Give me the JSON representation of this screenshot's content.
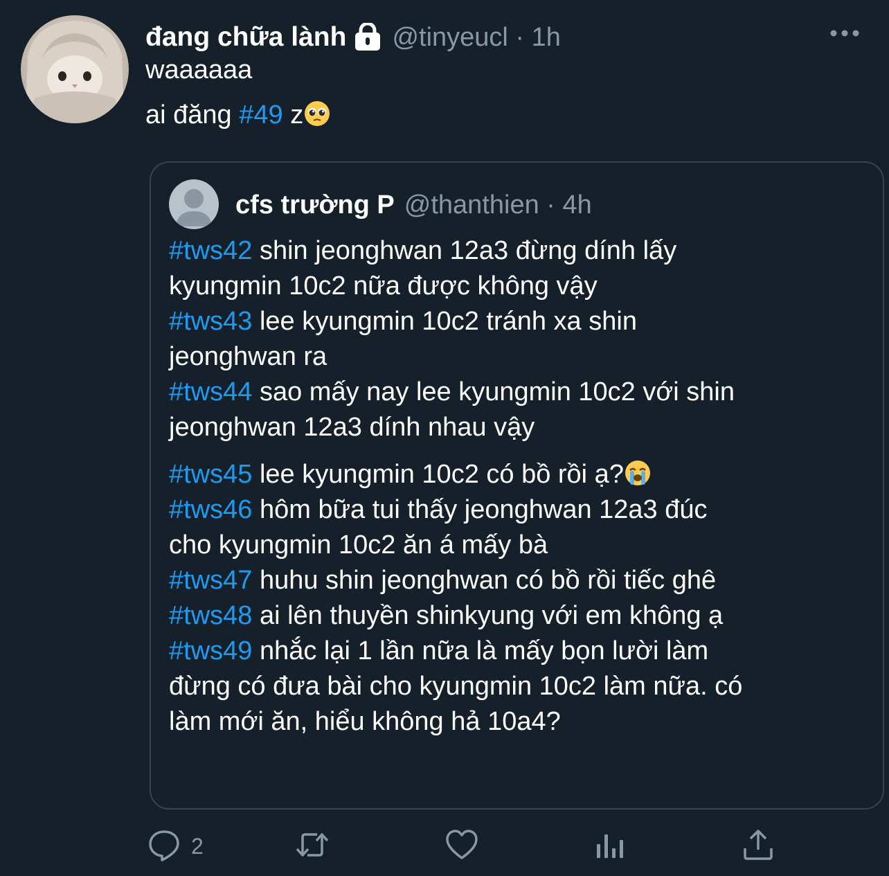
{
  "tweet": {
    "display_name": "đang chữa lành",
    "handle_time": "@tinyeucl · 1h",
    "line1": "waaaaaa",
    "line2_prefix": "ai đăng ",
    "line2_hashtag": "#49",
    "line2_suffix": " z",
    "icons": {
      "lock": "lock-icon",
      "more": "more-icon",
      "emoji": "pleading-face-emoji"
    }
  },
  "quote": {
    "display_name": "cfs trường P",
    "handle_time": "@thanthien · 4h",
    "lines": [
      {
        "tag": "#tws42",
        "text": " shin jeonghwan 12a3 đừng dính lấy"
      },
      {
        "tag": "",
        "text": "kyungmin 10c2 nữa được không vậy"
      },
      {
        "tag": "#tws43",
        "text": " lee kyungmin 10c2 tránh xa shin"
      },
      {
        "tag": "",
        "text": "jeonghwan ra"
      },
      {
        "tag": "#tws44",
        "text": " sao mấy nay lee kyungmin 10c2 với shin"
      },
      {
        "tag": "",
        "text": "jeonghwan 12a3 dính nhau vậy"
      },
      {
        "tag": "#tws45",
        "text": " lee kyungmin 10c2 có bồ rồi ạ?"
      },
      {
        "tag": "#tws46",
        "text": " hôm bữa tui thấy jeonghwan 12a3 đúc"
      },
      {
        "tag": "",
        "text": "cho kyungmin 10c2 ăn á mấy bà"
      },
      {
        "tag": "#tws47",
        "text": " huhu shin jeonghwan có bồ rồi tiếc ghê"
      },
      {
        "tag": "#tws48",
        "text": " ai lên thuyền shinkyung với em không ạ"
      },
      {
        "tag": "#tws49",
        "text": " nhắc lại 1 lần nữa là mấy bọn lười làm"
      },
      {
        "tag": "",
        "text": "đừng có đưa bài cho kyungmin 10c2 làm nữa. có"
      },
      {
        "tag": "",
        "text": "làm mới ăn, hiểu không hả 10a4?"
      }
    ]
  },
  "actions": {
    "reply_count": "2",
    "icons": [
      "reply-icon",
      "retweet-icon",
      "like-icon",
      "analytics-icon",
      "share-icon"
    ]
  },
  "colors": {
    "background": "#15202b",
    "hashtag": "#1d9bf0",
    "muted": "#8899a6",
    "border": "#38444d"
  }
}
